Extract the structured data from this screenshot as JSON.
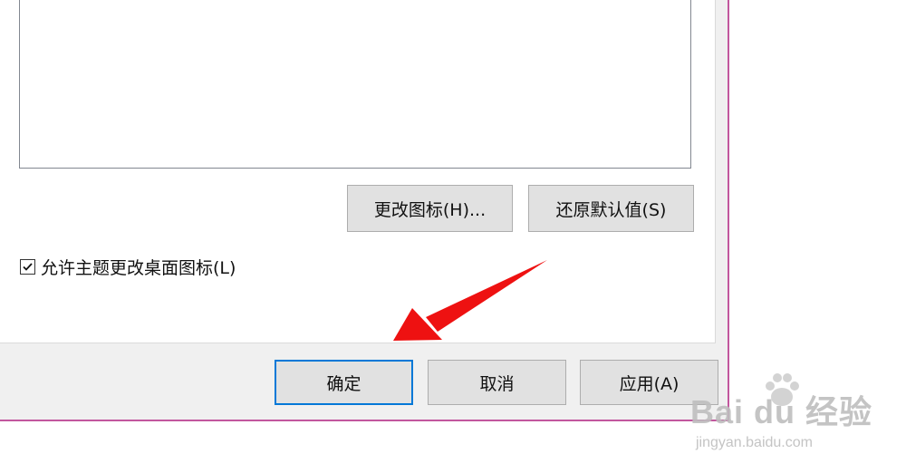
{
  "upper_buttons": {
    "change_icon": "更改图标(H)...",
    "restore_default": "还原默认值(S)"
  },
  "checkbox": {
    "label": "允许主题更改桌面图标(L)",
    "checked": true
  },
  "footer_buttons": {
    "ok": "确定",
    "cancel": "取消",
    "apply": "应用(A)"
  },
  "watermark": {
    "logo": "Bai du 经验",
    "url": "jingyan.baidu.com"
  },
  "colors": {
    "dialog_bg": "#f0f0f0",
    "focus_border": "#0078d7",
    "window_border": "#c2579e",
    "arrow": "#ee1111"
  },
  "icons": [
    "checkbox-checked-icon",
    "red-arrow-annotation",
    "baidu-paw-icon"
  ]
}
